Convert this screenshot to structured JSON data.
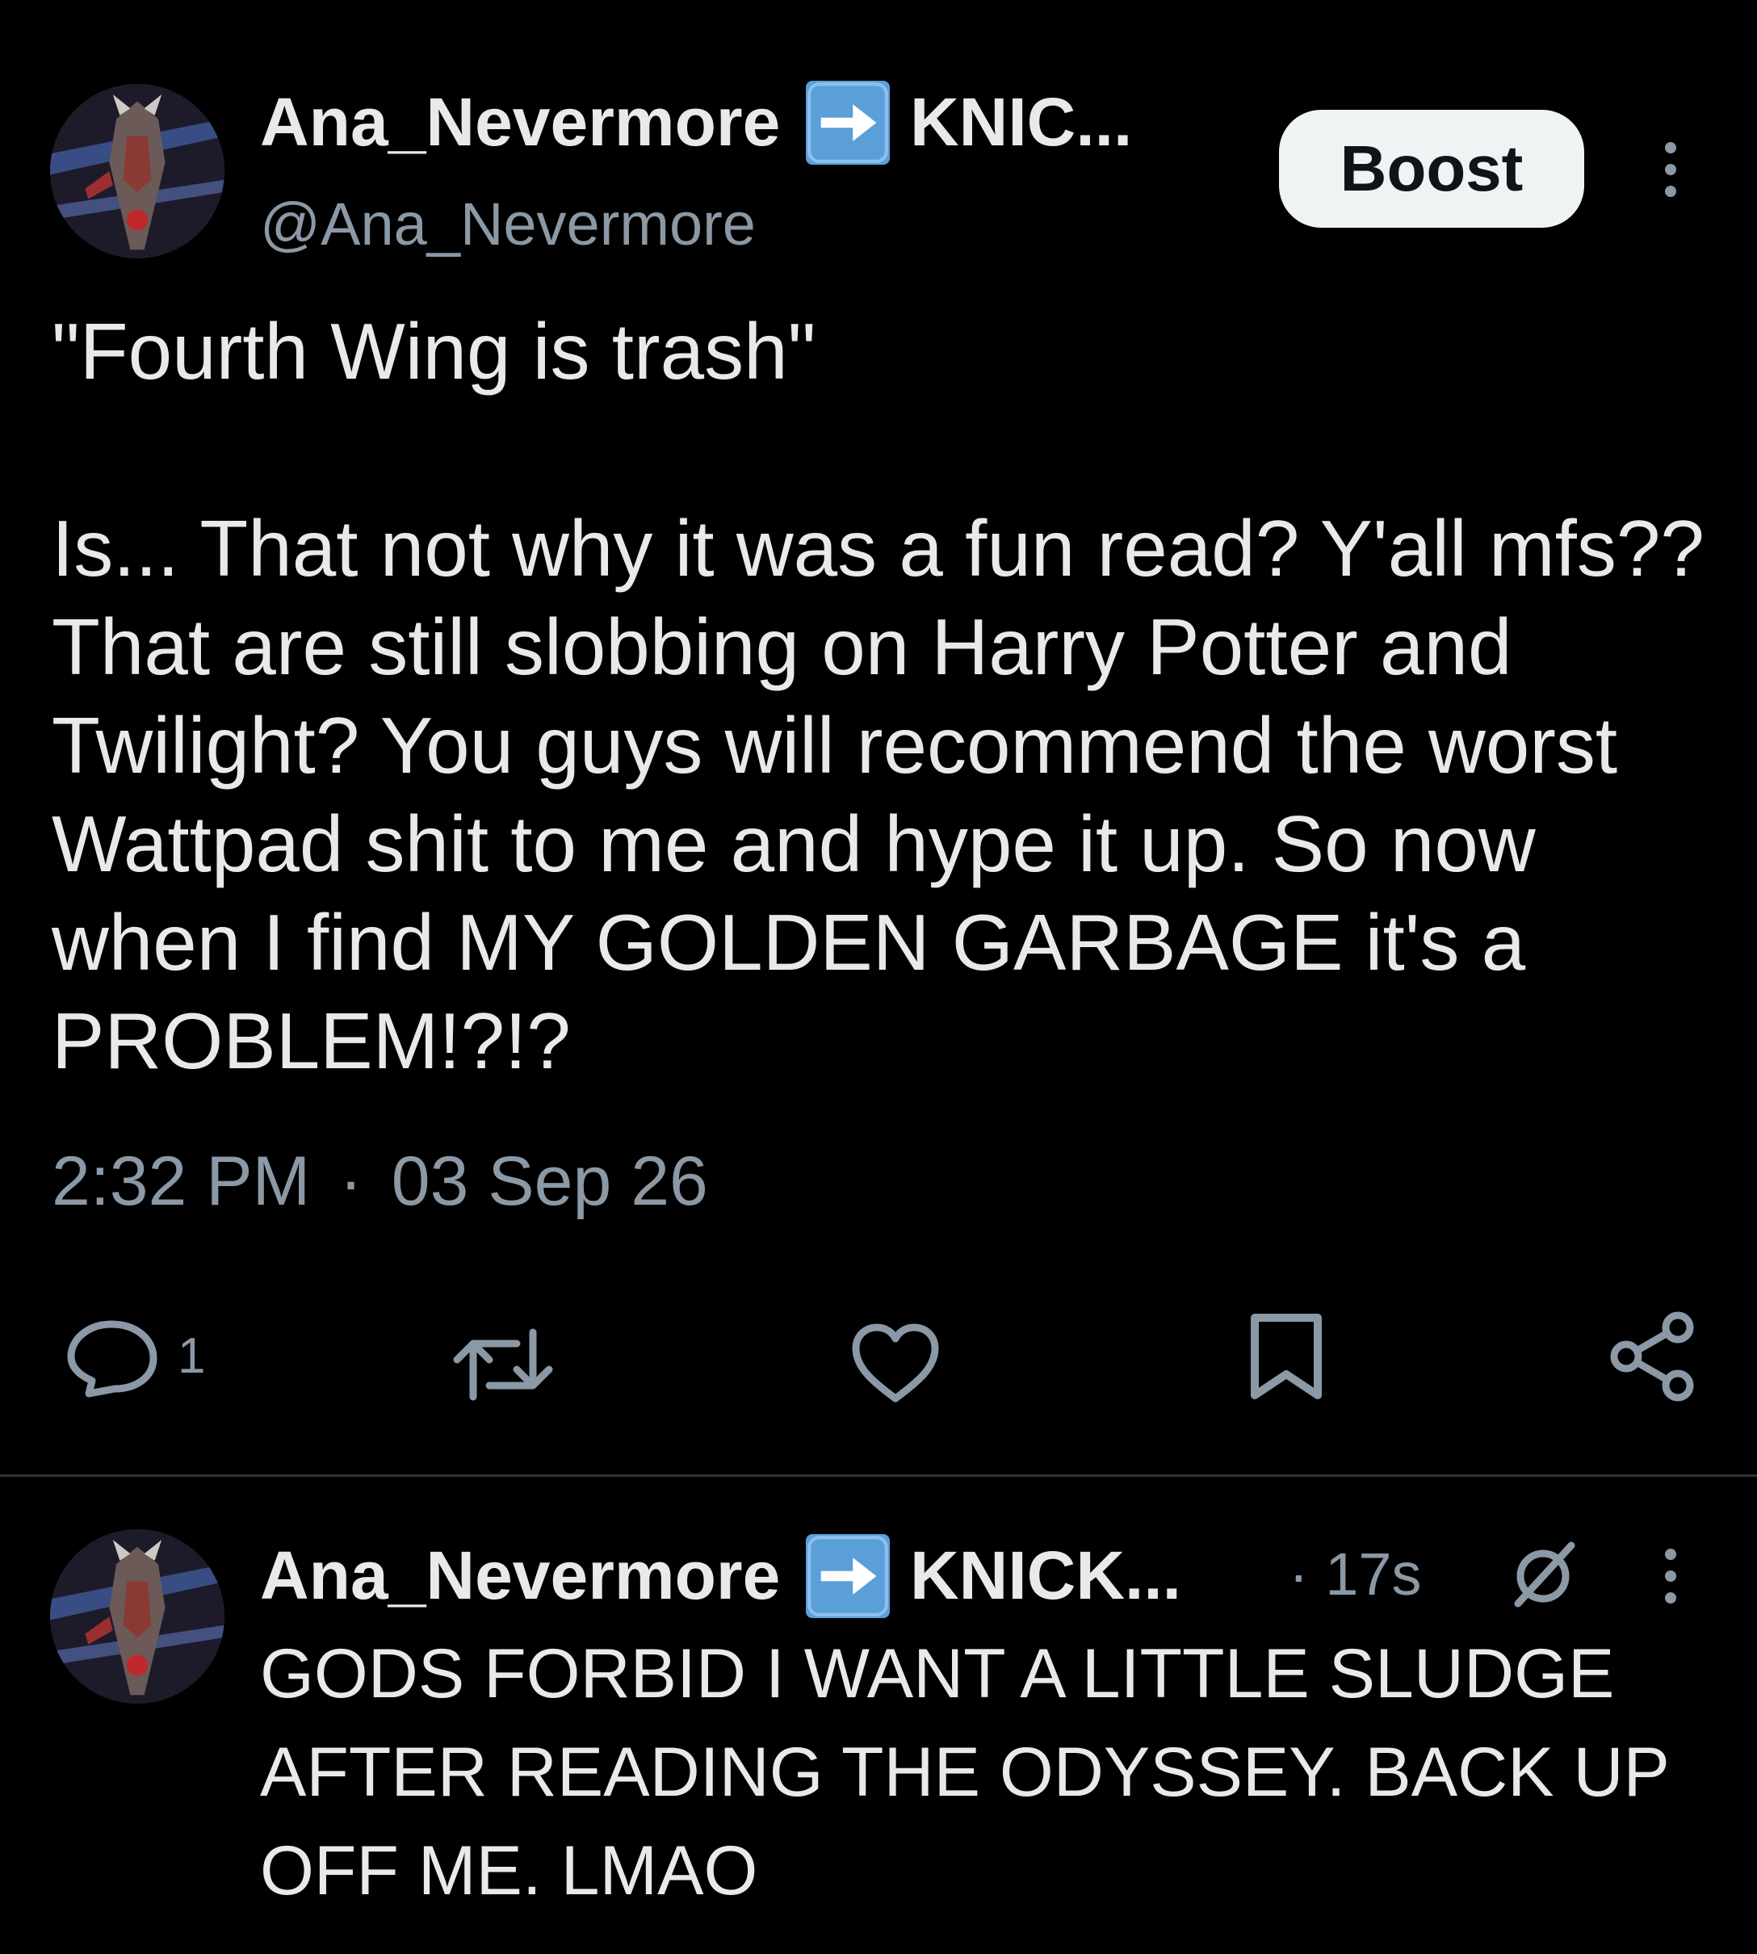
{
  "post": {
    "display_name": "Ana_Nevermore",
    "display_name_suffix": "KNIC...",
    "handle": "@Ana_Nevermore",
    "boost_label": "Boost",
    "text": "\"Fourth Wing is trash\"\n\nIs... That not why it was a fun read? Y'all mfs?? That are still slobbing on Harry Potter and Twilight? You guys will recommend the worst Wattpad shit to me and hype it up. So now when I find MY GOLDEN GARBAGE it's a PROBLEM!?!?",
    "time": "2:32 PM",
    "separator": "·",
    "date": "03 Sep 26",
    "reply_count": "1",
    "icons": {
      "reply": "comment-icon",
      "repost": "repost-icon",
      "like": "heart-icon",
      "bookmark": "bookmark-icon",
      "share": "share-icon",
      "more": "more-vertical-icon",
      "verified_arrow": "right-arrow-emoji-icon"
    }
  },
  "reply": {
    "display_name": "Ana_Nevermore",
    "display_name_suffix": "KNICK...",
    "time_ago": "· 17s",
    "text": "GODS FORBID I WANT A LITTLE SLUDGE\nAFTER READING THE ODYSSEY. BACK UP\nOFF ME. LMAO",
    "icons": {
      "status": "slashed-circle-icon",
      "more": "more-vertical-icon"
    }
  },
  "colors": {
    "background": "#000000",
    "text": "#e7e9ea",
    "muted": "#8b98a5",
    "boost_bg": "#eff3f4",
    "emoji_blue": "#5a9fd8"
  }
}
